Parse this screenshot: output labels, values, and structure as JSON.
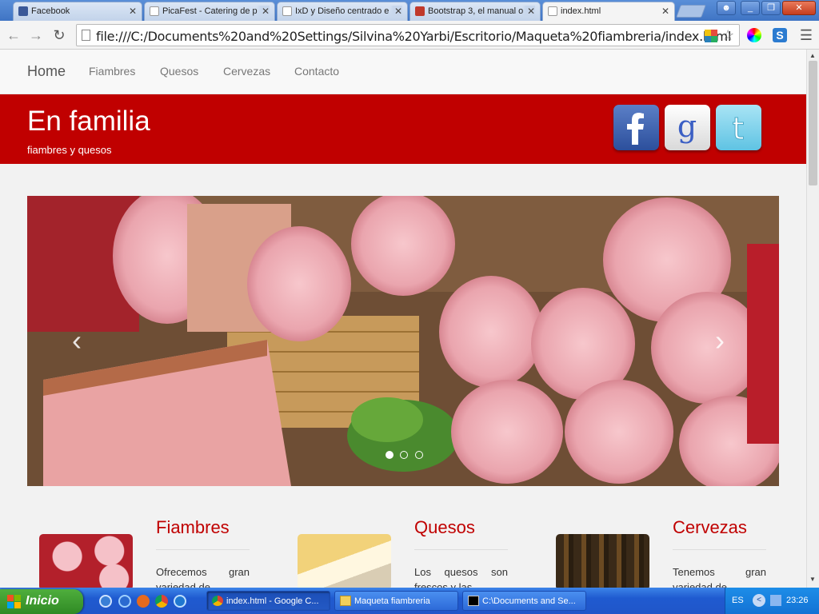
{
  "browser": {
    "tabs": [
      {
        "title": "Facebook",
        "icon": "facebook-icon",
        "color": "#3b5998"
      },
      {
        "title": "PicaFest - Catering de p",
        "icon": "page-icon",
        "color": "#ffffff"
      },
      {
        "title": "IxD y Diseño centrado e",
        "icon": "page-icon",
        "color": "#ffffff"
      },
      {
        "title": "Bootstrap 3, el manual o",
        "icon": "book-icon",
        "color": "#c0392b"
      },
      {
        "title": "index.html",
        "icon": "page-icon",
        "color": "#ffffff"
      }
    ],
    "url": "file:///C:/Documents%20and%20Settings/Silvina%20Yarbi/Escritorio/Maqueta%20fiambreria/index.html"
  },
  "site": {
    "nav": [
      "Home",
      "Fiambres",
      "Quesos",
      "Cervezas",
      "Contacto"
    ],
    "title": "En familia",
    "subtitle": "fiambres y quesos",
    "social": [
      "facebook-icon",
      "google-icon",
      "twitter-icon"
    ],
    "carousel": {
      "prev": "‹",
      "next": "›",
      "slides": 3,
      "active": 0
    },
    "sections": [
      {
        "title": "Fiambres",
        "text": "Ofrecemos gran variedad de"
      },
      {
        "title": "Quesos",
        "text": "Los quesos son frescos y las"
      },
      {
        "title": "Cervezas",
        "text": "Tenemos gran variedad de"
      }
    ],
    "accent": "#c00000"
  },
  "taskbar": {
    "start": "Inicio",
    "windows": [
      "index.html - Google C...",
      "Maqueta fiambreria",
      "C:\\Documents and Se..."
    ],
    "lang": "ES",
    "clock": "23:26"
  }
}
